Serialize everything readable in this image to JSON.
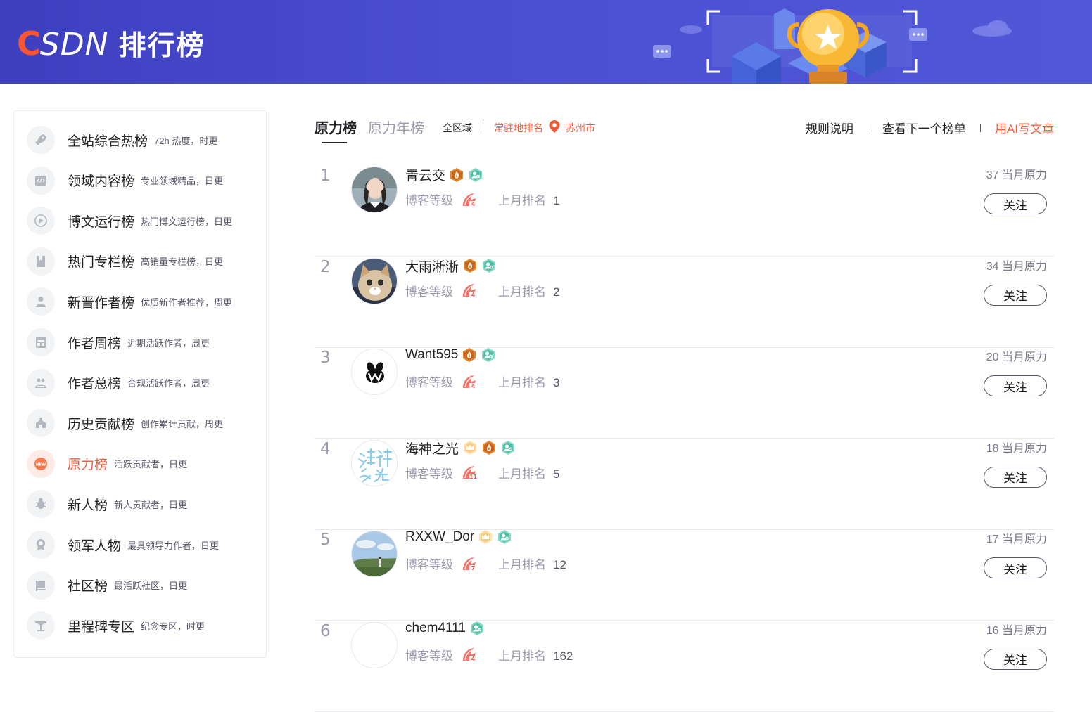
{
  "header": {
    "logo_c": "C",
    "logo_sdn": "SDN",
    "title": "排行榜"
  },
  "sidebar": {
    "items": [
      {
        "name": "全站综合热榜",
        "desc": "72h 热度，时更",
        "icon": "rocket-icon"
      },
      {
        "name": "领域内容榜",
        "desc": "专业领域精品，日更",
        "icon": "code-icon"
      },
      {
        "name": "博文运行榜",
        "desc": "热门博文运行榜，日更",
        "icon": "play-icon"
      },
      {
        "name": "热门专栏榜",
        "desc": "高销量专栏榜，日更",
        "icon": "book-icon"
      },
      {
        "name": "新晋作者榜",
        "desc": "优质新作者推荐，周更",
        "icon": "user-icon"
      },
      {
        "name": "作者周榜",
        "desc": "近期活跃作者，周更",
        "icon": "calendar-icon"
      },
      {
        "name": "作者总榜",
        "desc": "合规活跃作者，周更",
        "icon": "group-icon"
      },
      {
        "name": "历史贡献榜",
        "desc": "创作累计贡献，周更",
        "icon": "building-icon"
      },
      {
        "name": "原力榜",
        "desc": "活跃贡献者，日更",
        "icon": "new-icon",
        "active": true
      },
      {
        "name": "新人榜",
        "desc": "新人贡献者，日更",
        "icon": "bug-icon"
      },
      {
        "name": "领军人物",
        "desc": "最具领导力作者，日更",
        "icon": "medal-icon"
      },
      {
        "name": "社区榜",
        "desc": "最活跃社区，日更",
        "icon": "flag-icon"
      },
      {
        "name": "里程碑专区",
        "desc": "纪念专区，时更",
        "icon": "milestone-icon"
      }
    ]
  },
  "main": {
    "tab_active": "原力榜",
    "tab_other": "原力年榜",
    "region": "全区域",
    "resident": "常驻地排名",
    "city": "苏州市",
    "links": {
      "rules": "规则说明",
      "next": "查看下一个榜单",
      "ai": "用AI写文章"
    },
    "level_label": "博客等级",
    "last_rank_label": "上月排名",
    "power_suffix": "当月原力",
    "follow_label": "关注",
    "colors": {
      "accent": "#e85f3e",
      "banner": "#4a4fd0"
    },
    "rows": [
      {
        "rank": "1",
        "name": "青云交",
        "last": "1",
        "power": "37 当月原力",
        "badges": [
          "flame-badge-icon",
          "vip-badge-icon"
        ],
        "level": "4"
      },
      {
        "rank": "2",
        "name": "大雨淅淅",
        "last": "2",
        "power": "34 当月原力",
        "badges": [
          "flame-badge-icon",
          "vip-badge-icon"
        ],
        "level": "4"
      },
      {
        "rank": "3",
        "name": "Want595",
        "last": "3",
        "power": "20 当月原力",
        "badges": [
          "flame-badge-icon",
          "vip-badge-icon"
        ],
        "level": "4"
      },
      {
        "rank": "4",
        "name": "海神之光",
        "last": "5",
        "power": "18 当月原力",
        "badges": [
          "crown-badge-icon",
          "flame-badge-icon",
          "vip-badge-icon"
        ],
        "level": "11"
      },
      {
        "rank": "5",
        "name": "RXXW_Dor",
        "last": "12",
        "power": "17 当月原力",
        "badges": [
          "crown-badge-icon",
          "vip-badge-icon"
        ],
        "level": "7"
      },
      {
        "rank": "6",
        "name": "chem4111",
        "last": "162",
        "power": "16 当月原力",
        "badges": [
          "vip-badge-icon"
        ],
        "level": "4"
      }
    ]
  }
}
